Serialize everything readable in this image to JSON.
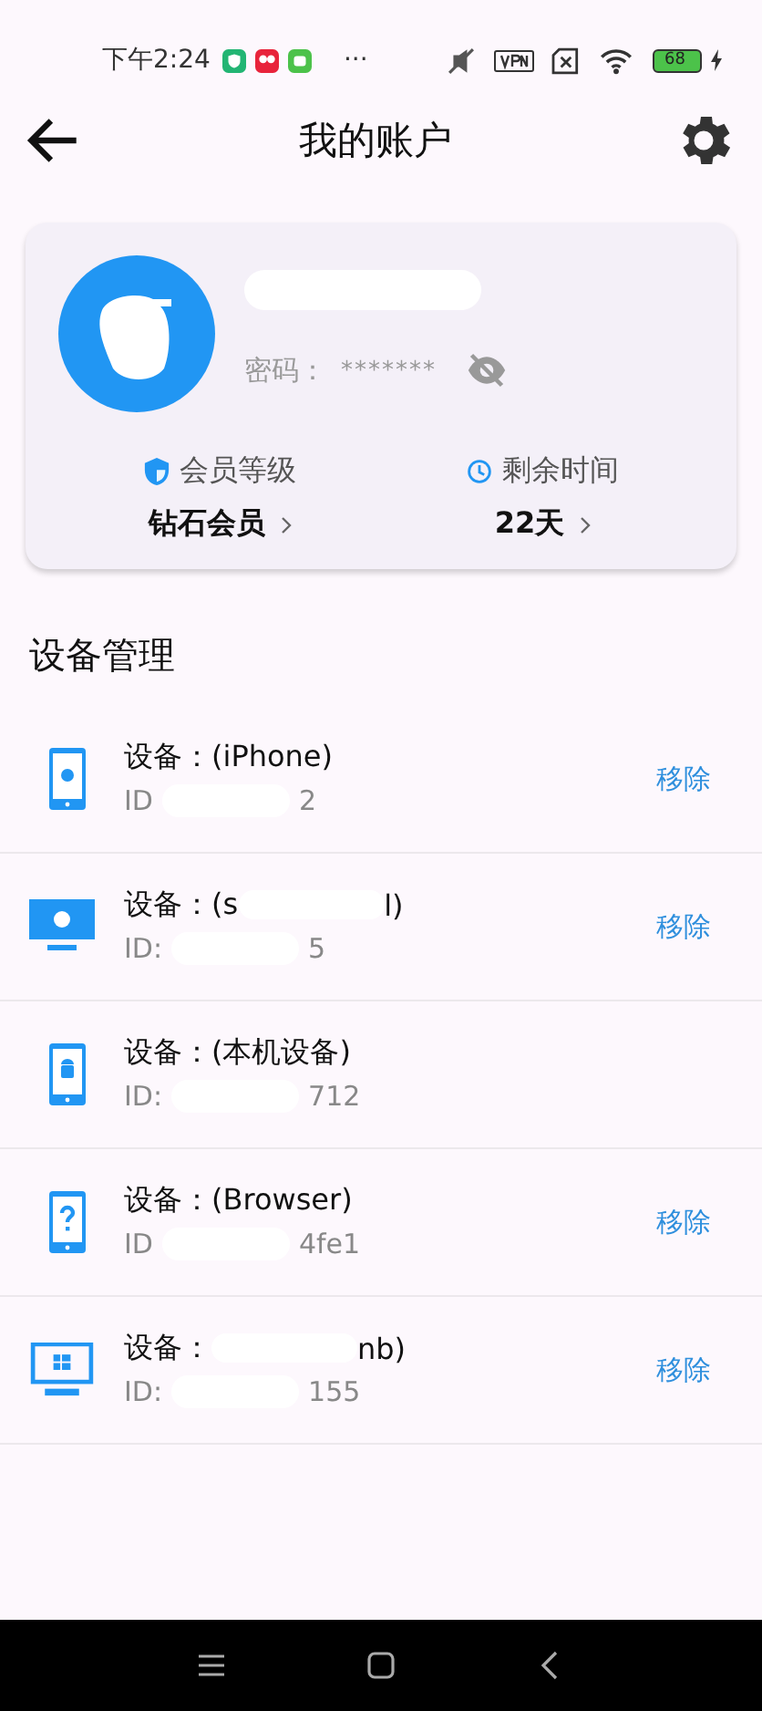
{
  "status_bar": {
    "time": "下午2:24",
    "more": "···",
    "battery": "68"
  },
  "header": {
    "title": "我的账户"
  },
  "account": {
    "password_label": "密码：",
    "password": "*******",
    "password_visible": false,
    "stats": [
      {
        "kind": "level",
        "label": "会员等级",
        "value": "钻石会员"
      },
      {
        "kind": "time",
        "label": "剩余时间",
        "value": "22天"
      }
    ]
  },
  "devices": {
    "title": "设备管理",
    "items": [
      {
        "kind": "iphone",
        "name_start": "设备：(iPhone)",
        "id_start": "ID",
        "id_end": "2",
        "action": "移除"
      },
      {
        "kind": "mac",
        "name_start": "设备：(s",
        "name_end": "l)",
        "id_start": "ID:",
        "id_end": "5",
        "action": "移除"
      },
      {
        "kind": "android",
        "name_start": "设备：(本机设备)",
        "id_start": "ID:",
        "id_end": "712"
      },
      {
        "kind": "unknown",
        "name_start": "设备：(Browser)",
        "id_start": "ID",
        "id_end": "4fe1",
        "action": "移除"
      },
      {
        "kind": "windows",
        "name_start": "设备：",
        "name_end": "nb)",
        "id_start": "ID:",
        "id_end": "155",
        "action": "移除"
      }
    ]
  }
}
